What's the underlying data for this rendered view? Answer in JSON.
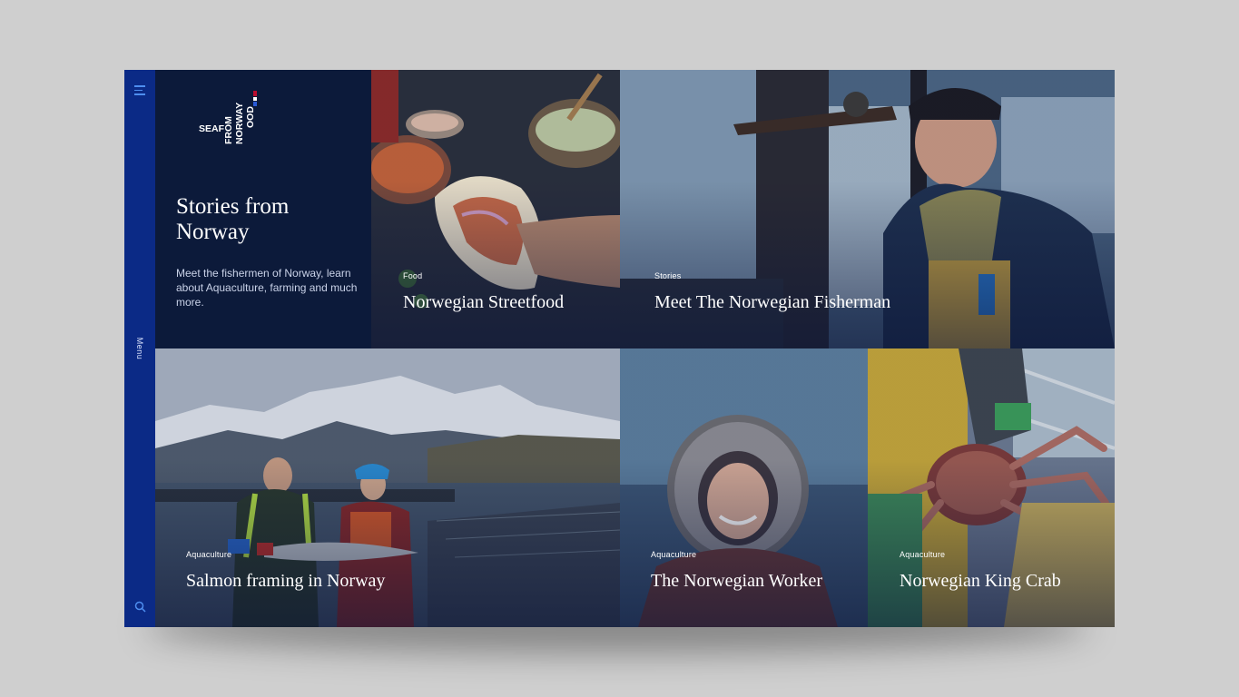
{
  "sidebar": {
    "menu_label": "Menu",
    "menu_icon": "hamburger-icon",
    "search_icon": "search-icon",
    "accent": "#0b2a86"
  },
  "brand": {
    "logo_text_line1": "SEAFOOD",
    "logo_text_line2": "FROM",
    "logo_text_line3": "NORWAY",
    "flag_colors": [
      "#ba0c2f",
      "#ffffff",
      "#00205b"
    ]
  },
  "intro": {
    "title": "Stories from Norway",
    "description": "Meet the fishermen of Norway, learn about Aquaculture, farming and much more."
  },
  "tiles": [
    {
      "category": "Food",
      "title": "Norwegian Streetfood"
    },
    {
      "category": "Stories",
      "title": "Meet The Norwegian Fisherman"
    },
    {
      "category": "Aquaculture",
      "title": "Salmon framing in Norway"
    },
    {
      "category": "Aquaculture",
      "title": "The Norwegian Worker"
    },
    {
      "category": "Aquaculture",
      "title": "Norwegian King Crab"
    }
  ]
}
